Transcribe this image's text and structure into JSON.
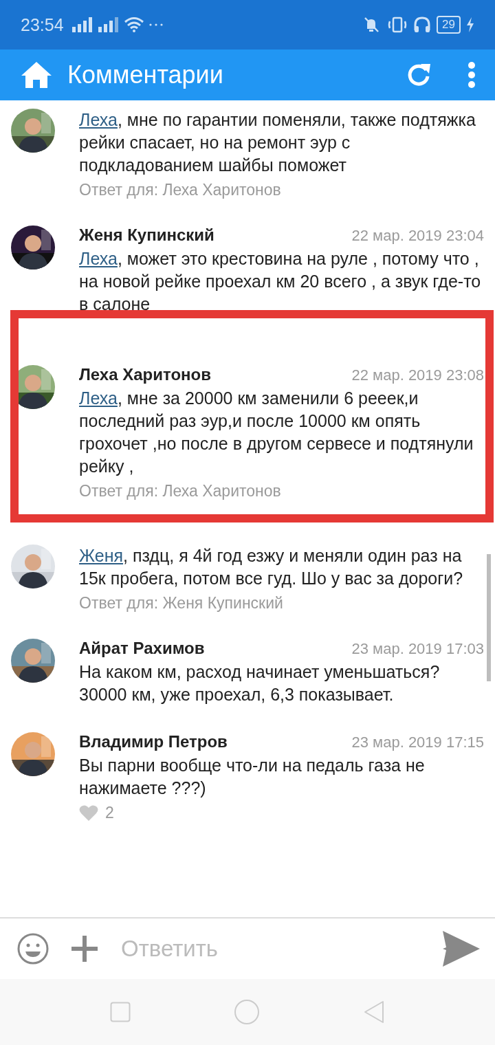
{
  "status_bar": {
    "time": "23:54",
    "battery": "29"
  },
  "app_bar": {
    "title": "Комментарии"
  },
  "comments": [
    {
      "mention": "Леха",
      "text": ", мне по гарантии поменяли, также подтяжка рейки спасает, но на ремонт эур с подкладованием шайбы поможет",
      "reply": "Ответ для: Леха Харитонов"
    },
    {
      "name": "Женя Купинский",
      "date": "22 мар. 2019 23:04",
      "mention": "Леха",
      "text": ", может это крестовина на руле , потому что , на новой рейке проехал км 20 всего , а звук где-то в салоне"
    },
    {
      "name": "Леха Харитонов",
      "date": "22 мар. 2019 23:08",
      "mention": "Леха",
      "text": ", мне за 20000 км заменили 6 рееек,и последний раз эур,и после 10000 км опять грохочет ,но после в другом сервесе и подтянули рейку ,",
      "reply": "Ответ для: Леха Харитонов",
      "highlighted": true
    },
    {
      "mention": "Женя",
      "text": ", пздц, я 4й год езжу и меняли один раз на 15к пробега, потом все гуд. Шо у вас за дороги?",
      "reply": "Ответ для: Женя Купинский"
    },
    {
      "name": "Айрат Рахимов",
      "date": "23 мар. 2019 17:03",
      "text": "На каком км, расход начинает уменьшаться? 30000 км, уже проехал, 6,3 показывает."
    },
    {
      "name": "Владимир Петров",
      "date": "23 мар. 2019 17:15",
      "text": "Вы парни вообще что-ли на педаль газа не нажимаете ???)",
      "likes": "2"
    }
  ],
  "composer": {
    "placeholder": "Ответить"
  }
}
